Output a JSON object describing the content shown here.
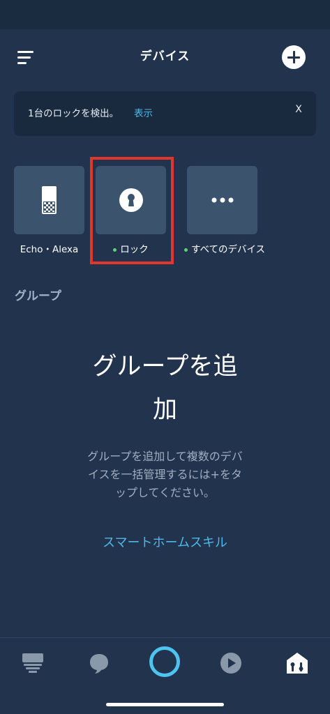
{
  "header": {
    "title": "デバイス",
    "menu_icon": "hamburger-menu-icon",
    "add_icon": "plus-circle-icon"
  },
  "banner": {
    "message": "1台のロックを検出。",
    "link": "表示",
    "close": "X"
  },
  "device_tiles": [
    {
      "label": "Echo・Alexa",
      "icon": "echo-speaker-icon",
      "online": false
    },
    {
      "label": "ロック",
      "icon": "keyhole-lock-icon",
      "online": true
    },
    {
      "label": "すべてのデバイス",
      "icon": "more-dots-icon",
      "online": true
    }
  ],
  "groups": {
    "section_label": "グループ",
    "empty_title_line1": "グループを追",
    "empty_title_line2": "加",
    "empty_desc_line1": "グループを追加して複数のデバ",
    "empty_desc_line2": "イスを一括管理するには+をタ",
    "empty_desc_line3": "ップしてください。",
    "skill_link": "スマートホームスキル"
  },
  "bottom_nav": [
    {
      "name": "home",
      "icon": "home-dashboard-icon",
      "active": false
    },
    {
      "name": "communicate",
      "icon": "speech-bubble-icon",
      "active": false
    },
    {
      "name": "alexa",
      "icon": "alexa-ring-icon",
      "active": false
    },
    {
      "name": "play",
      "icon": "play-icon",
      "active": false
    },
    {
      "name": "devices",
      "icon": "devices-house-icon",
      "active": true
    }
  ],
  "colors": {
    "background": "#22344d",
    "tile": "#3b536d",
    "accent_link": "#4db8ea",
    "online_dot": "#5fd07a",
    "highlight": "#e0362b",
    "alexa_ring": "#4dc3f0"
  }
}
